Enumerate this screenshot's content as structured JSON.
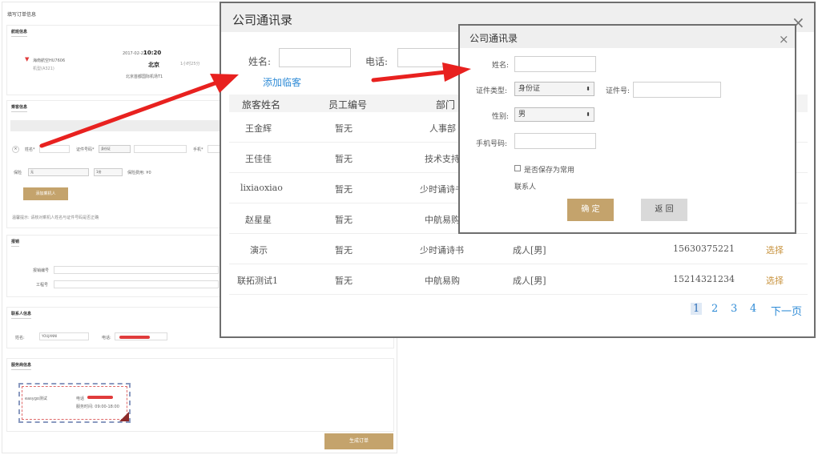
{
  "order_page": {
    "title": "填写订单信息",
    "flight_section": {
      "title": "航班信息",
      "airline": "海南航空HU7606",
      "airline_sub": "机型(A321)",
      "date": "2017-02-22",
      "dep_time": "10:20",
      "dep_city": "北京",
      "dep_airport": "北京首都国际机场T1",
      "duration": "1小时25分"
    },
    "passenger_section": {
      "title": "乘客信息",
      "name_label": "姓名*",
      "id_type_label": "证件号码*",
      "id_type_value": "身份证",
      "phone_label": "手机*",
      "insurance_label": "保险",
      "insurance_value": "无",
      "count_value": "1份",
      "insurance_fee_label": "保险费用: ¥0",
      "add_button": "添加乘机人",
      "note": "温馨提示: 请核对乘机人姓名与证件号码是否正确"
    },
    "receipt_section": {
      "title": "报销",
      "field1": "报销编号",
      "field2": "工程号"
    },
    "contact_section": {
      "title": "联系人信息",
      "name_label": "姓名:",
      "name_value": "YOUJANNI",
      "phone_label": "电话:"
    },
    "service_section": {
      "title": "服务商信息",
      "provider": "easygo测试",
      "phone_label": "电话",
      "hours_label": "服务时间: 09:00-18:00"
    },
    "submit_button": "生成订单"
  },
  "directory_dialog": {
    "title": "公司通讯录",
    "name_label": "姓名:",
    "phone_label": "电话:",
    "add_link": "添加临客",
    "columns": [
      "旅客姓名",
      "员工编号",
      "部门"
    ],
    "rows": [
      {
        "name": "王金辉",
        "emp_no": "暂无",
        "dept": "人事部",
        "type": "",
        "phone": "",
        "action": ""
      },
      {
        "name": "王佳佳",
        "emp_no": "暂无",
        "dept": "技术支持",
        "type": "",
        "phone": "",
        "action": ""
      },
      {
        "name": "lixiaoxiao",
        "emp_no": "暂无",
        "dept": "少时诵诗书",
        "type": "",
        "phone": "",
        "action": ""
      },
      {
        "name": "赵星星",
        "emp_no": "暂无",
        "dept": "中航易购",
        "type": "",
        "phone": "",
        "action": ""
      },
      {
        "name": "演示",
        "emp_no": "暂无",
        "dept": "少时诵诗书",
        "type": "成人[男]",
        "phone": "15630375221",
        "action": "选择"
      },
      {
        "name": "联拓测试1",
        "emp_no": "暂无",
        "dept": "中航易购",
        "type": "成人[男]",
        "phone": "15214321234",
        "action": "选择"
      }
    ],
    "pager": [
      "1",
      "2",
      "3",
      "4",
      "下一页"
    ]
  },
  "add_guest_dialog": {
    "title": "公司通讯录",
    "name_label": "姓名:",
    "id_type_label": "证件类型:",
    "id_type_value": "身份证",
    "id_no_label": "证件号:",
    "gender_label": "性别:",
    "gender_value": "男",
    "mobile_label": "手机号码:",
    "save_label": "是否保存为常用",
    "save_label2": "联系人",
    "ok_button": "确 定",
    "back_button": "返 回"
  },
  "colors": {
    "accent_gold": "#c4a36c",
    "link_blue": "#2f8bd6",
    "arrow_red": "#e8211f"
  }
}
